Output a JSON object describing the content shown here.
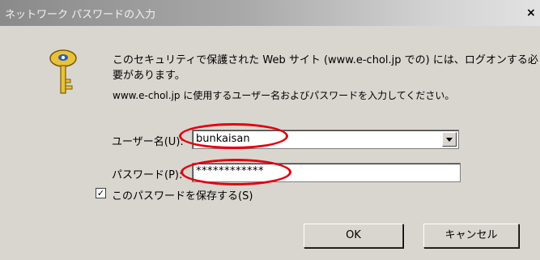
{
  "dialog": {
    "title": "ネットワーク パスワードの入力",
    "close_glyph": "×",
    "message_line1": "このセキュリティで保護された Web サイト (www.e-chol.jp での) には、ログオンする必",
    "message_line2": "要があります。",
    "message_line3": "www.e-chol.jp に使用するユーザー名およびパスワードを入力してください。"
  },
  "form": {
    "username_label": "ユーザー名(U):",
    "username_value": "bunkaisan",
    "password_label": "パスワード(P):",
    "password_value": "************",
    "save_checked_glyph": "✓",
    "save_label": "このパスワードを保存する(S)"
  },
  "buttons": {
    "ok_label": "OK",
    "cancel_label": "キャンセル"
  },
  "icons": {
    "key": "key-icon",
    "dropdown": "chevron-down-icon"
  },
  "colors": {
    "annotation_ring": "#e3000f",
    "dialog_bg": "#d9d6cf"
  }
}
